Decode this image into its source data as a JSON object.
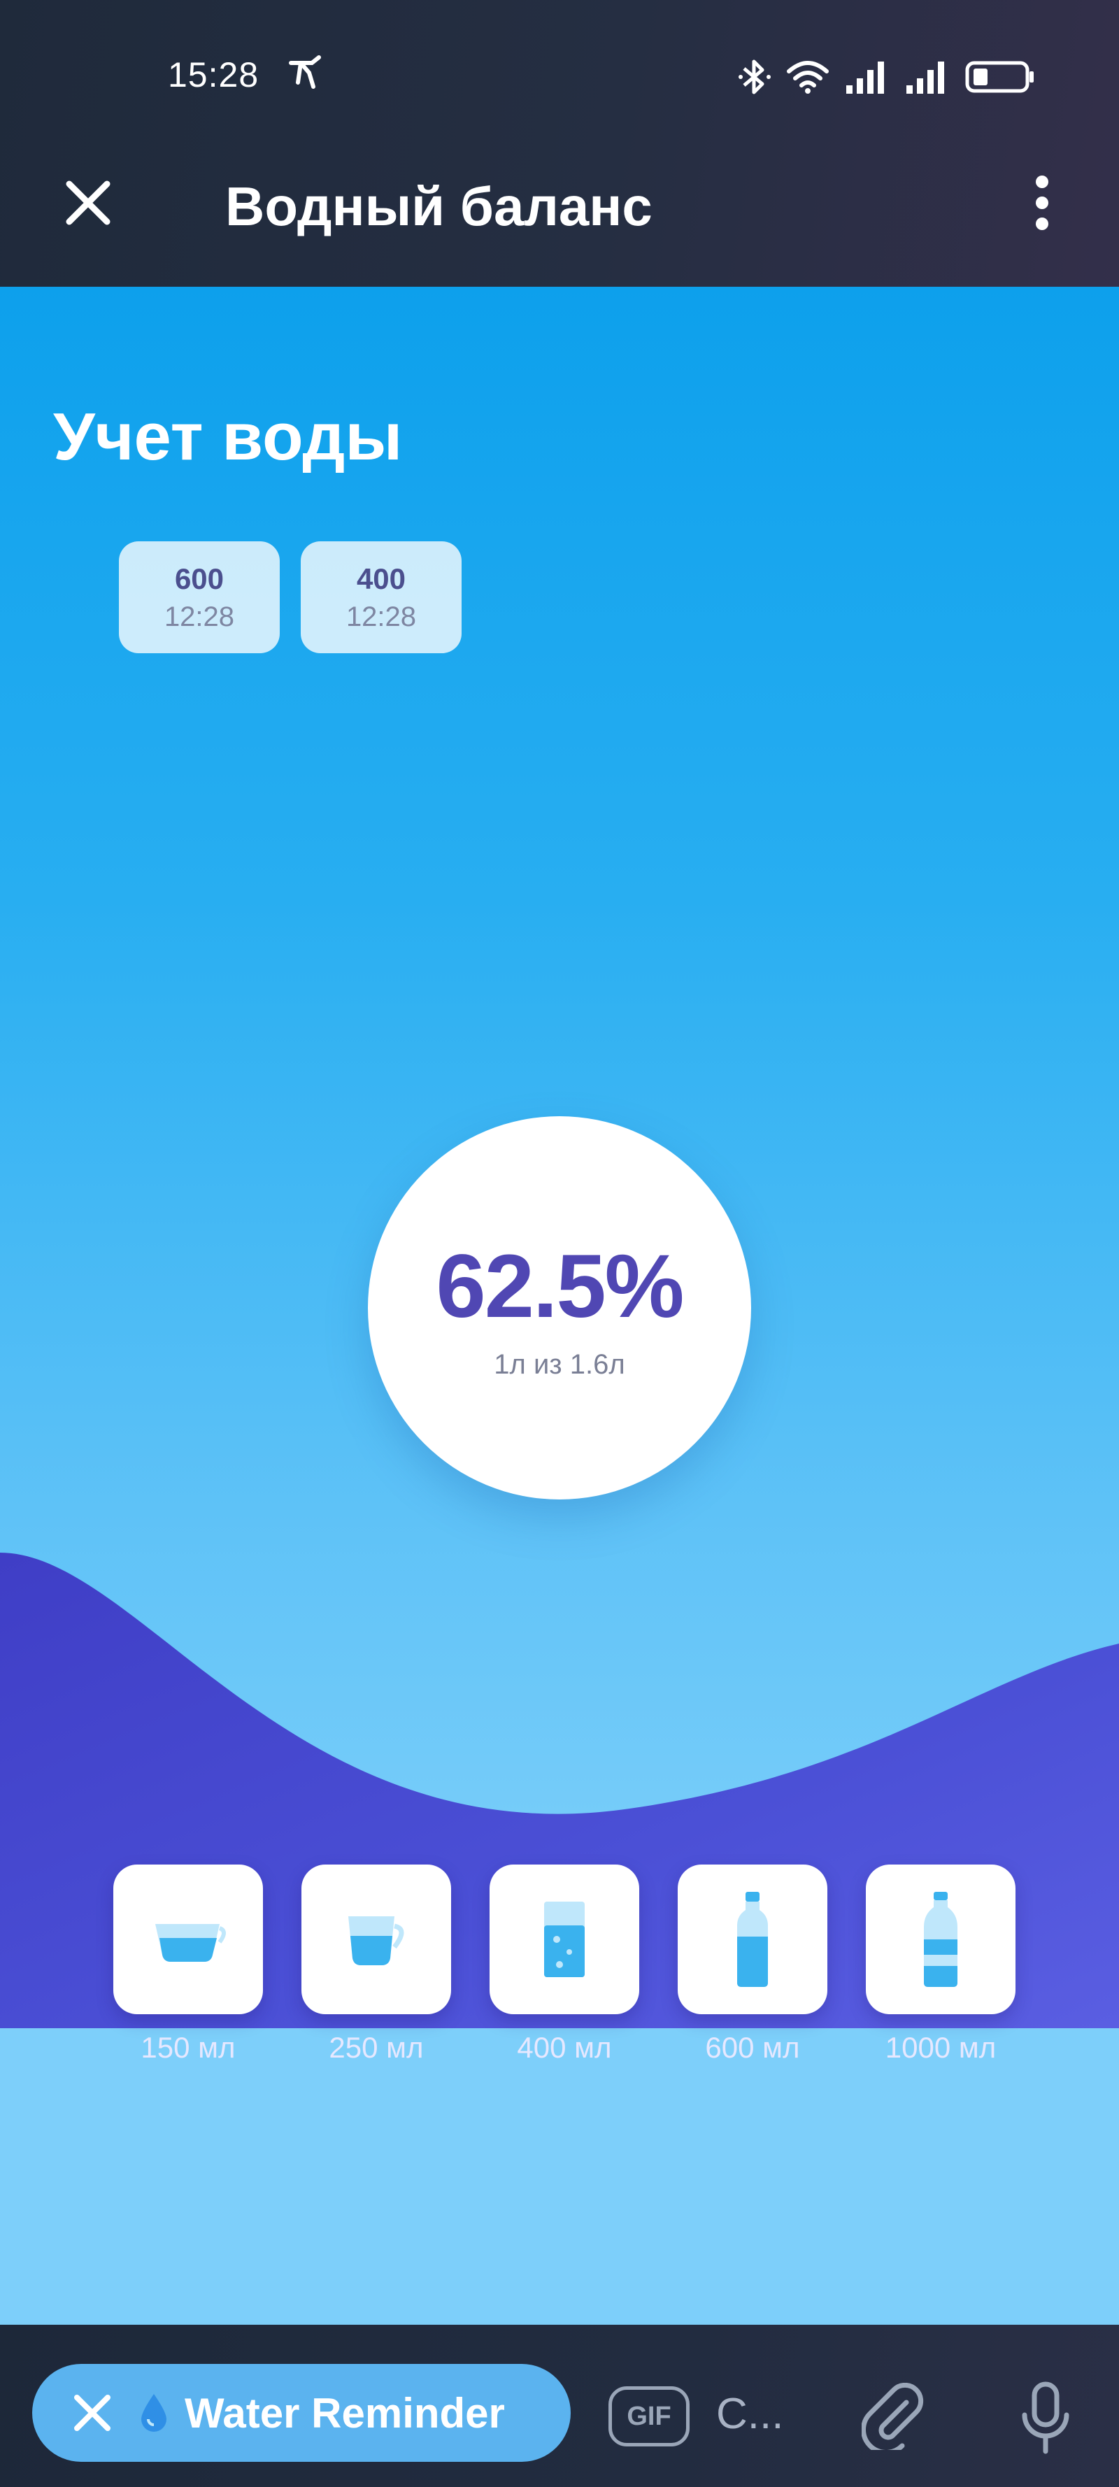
{
  "status_bar": {
    "time": "15:28",
    "left_icon": "running-figure-icon",
    "icons": [
      "bluetooth-icon",
      "wifi-icon",
      "signal-icon",
      "signal-icon",
      "battery-icon"
    ]
  },
  "app_bar": {
    "title": "Водный баланс",
    "close_icon": "close-icon",
    "more_icon": "more-vertical-icon"
  },
  "main": {
    "section_title": "Учет воды",
    "log_entries": [
      {
        "amount": "600",
        "time": "12:28"
      },
      {
        "amount": "400",
        "time": "12:28"
      }
    ],
    "progress": {
      "percent_label": "62.5%",
      "percent_value": 62.5,
      "detail": "1л из 1.6л"
    },
    "drinks": [
      {
        "label": "150 мл",
        "icon": "bowl-icon"
      },
      {
        "label": "250 мл",
        "icon": "cup-icon"
      },
      {
        "label": "400 мл",
        "icon": "glass-icon"
      },
      {
        "label": "600 мл",
        "icon": "bottle-icon"
      },
      {
        "label": "1000 мл",
        "icon": "large-bottle-icon"
      }
    ]
  },
  "bottom_bar": {
    "bot_label": "Water Reminder",
    "bot_icons": [
      "close-icon",
      "water-drop-icon"
    ],
    "gif_label": "GIF",
    "input_text": "С...",
    "attach_icon": "paperclip-icon",
    "mic_icon": "microphone-icon"
  },
  "colors": {
    "topbar": "#1f2a3b",
    "water_top": "#0da0ec",
    "water_bottom": "#7dcffa",
    "wave": "#4f4fd0",
    "percent_text": "#5047b3",
    "bot_chip": "#5bb3ef"
  }
}
